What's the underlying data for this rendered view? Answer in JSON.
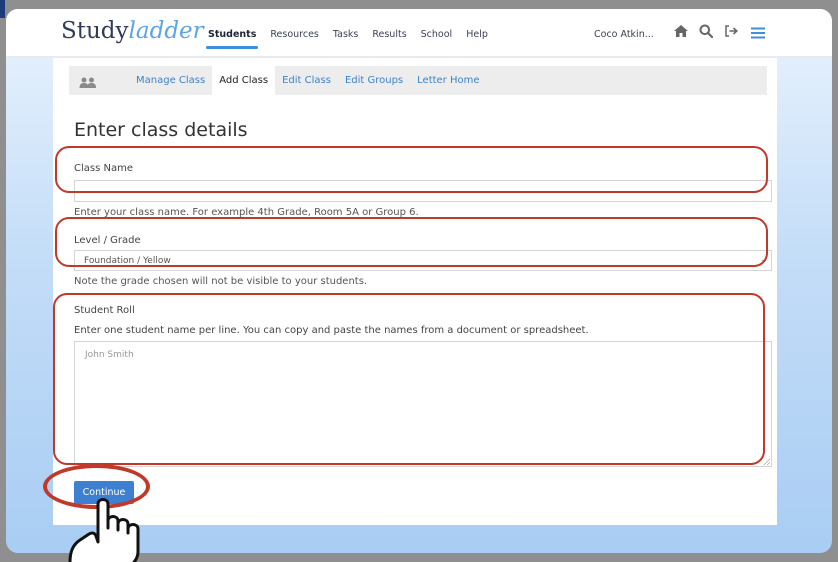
{
  "brand": {
    "name_plain": "Study",
    "name_italic": "ladder"
  },
  "nav": {
    "items": [
      {
        "label": "Students",
        "active": true
      },
      {
        "label": "Resources"
      },
      {
        "label": "Tasks"
      },
      {
        "label": "Results"
      },
      {
        "label": "School"
      },
      {
        "label": "Help"
      }
    ],
    "user": "Coco Atkin...",
    "icons": [
      "home-icon",
      "search-icon",
      "logout-icon",
      "menu-icon"
    ]
  },
  "subnav": {
    "icon": "users-icon",
    "items": [
      {
        "label": "Manage Class"
      },
      {
        "label": "Add Class",
        "active": true
      },
      {
        "label": "Edit Class"
      },
      {
        "label": "Edit Groups"
      },
      {
        "label": "Letter Home"
      }
    ]
  },
  "form": {
    "title": "Enter class details",
    "class_name": {
      "label": "Class Name",
      "value": "",
      "help": "Enter your class name. For example 4th Grade, Room 5A or Group 6."
    },
    "level": {
      "label": "Level / Grade",
      "value": "Foundation / Yellow",
      "help": "Note the grade chosen will not be visible to your students."
    },
    "roll": {
      "label": "Student Roll",
      "help": "Enter one student name per line. You can copy and paste the names from a document or spreadsheet.",
      "placeholder": "John Smith"
    },
    "continue_label": "Continue"
  },
  "colors": {
    "accent": "#3d7fd0",
    "highlight": "#c0392b",
    "link": "#3d82c9"
  }
}
